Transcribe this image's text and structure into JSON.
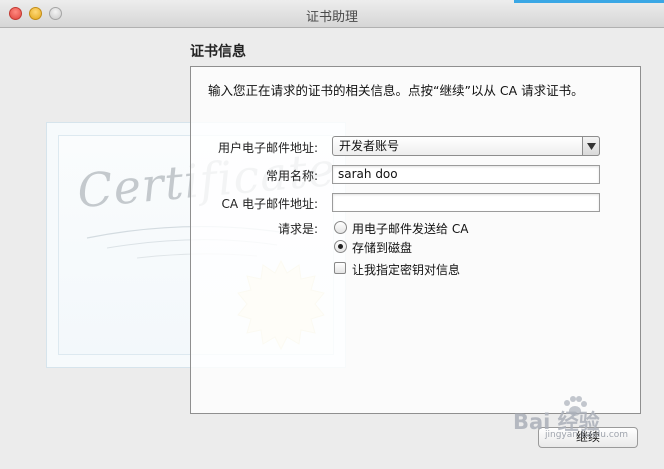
{
  "window": {
    "title": "证书助理",
    "section_title": "证书信息"
  },
  "intro_text": "输入您正在请求的证书的相关信息。点按“继续”以从 CA 请求证书。",
  "certificate_art": {
    "word": "Certificate"
  },
  "form": {
    "email_label": "用户电子邮件地址:",
    "email_value": "开发者账号",
    "common_name_label": "常用名称:",
    "common_name_value": "sarah doo",
    "ca_email_label": "CA 电子邮件地址:",
    "ca_email_value": "",
    "request_label": "请求是:",
    "options": [
      {
        "label": "用电子邮件发送给 CA",
        "selected": false
      },
      {
        "label": "存储到磁盘",
        "selected": true
      }
    ],
    "custom_key_label": "让我指定密钥对信息",
    "custom_key_checked": false
  },
  "buttons": {
    "continue": "继续"
  },
  "watermark": {
    "text": "Bai 经验",
    "url": "jingyan.baidu.com"
  },
  "colors": {
    "accent": "#3aa7e5"
  }
}
